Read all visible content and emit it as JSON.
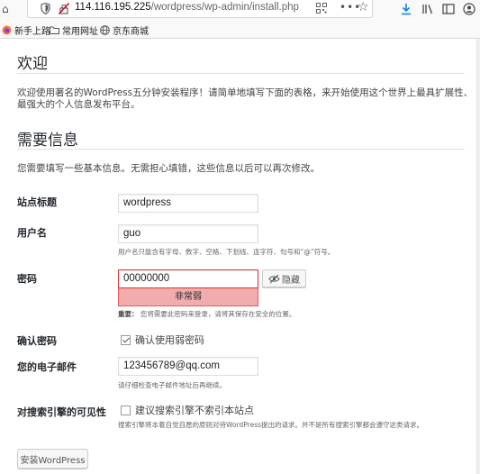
{
  "browser": {
    "url_host": "114.116.195.225",
    "url_path": "/wordpress/wp-admin/install.php",
    "bookmarks": [
      {
        "label": "新手上路",
        "icon": "firefox-icon"
      },
      {
        "label": "常用网址",
        "icon": "folder-icon"
      },
      {
        "label": "京东商城",
        "icon": "globe-icon"
      }
    ]
  },
  "welcome": {
    "title": "欢迎",
    "intro_line1": "欢迎使用著名的WordPress五分钟安装程序！请简单地填写下面的表格，来开始使用这个世界上最具扩展性、",
    "intro_line2": "最强大的个人信息发布平台。"
  },
  "info": {
    "title": "需要信息",
    "subtitle": "您需要填写一些基本信息。无需担心填错，这些信息以后可以再次修改。"
  },
  "form": {
    "site_title_label": "站点标题",
    "site_title_value": "wordpress",
    "username_label": "用户名",
    "username_value": "guo",
    "username_desc": "用户名只能含有字母、数字、空格、下划线、连字符、句号和“@”符号。",
    "password_label": "密码",
    "password_value": "00000000",
    "password_strength": "非常弱",
    "hide_label": "隐藏",
    "password_hint_bold": "重要：",
    "password_hint": "您将需要此密码来登录，请将其保存在安全的位置。",
    "confirm_label": "确认密码",
    "confirm_checkbox_label": "确认使用弱密码",
    "confirm_checked": true,
    "email_label": "您的电子邮件",
    "email_value": "123456789@qq.com",
    "email_desc": "请仔细检查电子邮件地址后再继续。",
    "seo_label": "对搜索引擎的可见性",
    "seo_checkbox_label": "建议搜索引擎不索引本站点",
    "seo_checked": false,
    "seo_desc": "搜索引擎将本着自觉自愿的原则对待WordPress提出的请求。并不是所有搜索引擎都会遵守这类请求。",
    "install_button": "安装WordPress"
  },
  "colors": {
    "strength_bg": "#f1adad",
    "strength_border": "#e35b5b",
    "page_bg": "#f1f1f1"
  }
}
